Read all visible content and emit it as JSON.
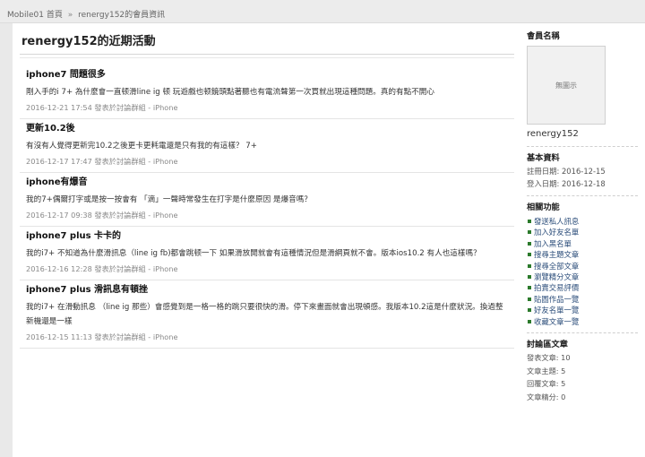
{
  "breadcrumb": {
    "site": "Mobile01 首頁",
    "separator": "»",
    "current": "renergy152的會員資訊"
  },
  "main": {
    "title": "renergy152的近期活動",
    "posts": [
      {
        "title": "iphone7 問題很多",
        "excerpt": "剛入手的i 7+ 為什麼會一直顿滑line ig 顿 玩遊戲也顿鏡頭點著聽也有電流聲第一次買就出現這種問題。真的有點不開心",
        "date": "2016-12-21 17:54",
        "meta_text": "發表於討論群組 - ",
        "forum": "iPhone"
      },
      {
        "title": "更新10.2後",
        "excerpt": "有沒有人覺得更新完10.2之後更卡更耗電還是只有我的有這樣？ 7+",
        "date": "2016-12-17 17:47",
        "meta_text": "發表於討論群組 - ",
        "forum": "iPhone"
      },
      {
        "title": "iphone有爆音",
        "excerpt": "我的7+偶爾打字或是按一按會有 「滴」一聲時常發生在打字是什麼原因 是爆音嗎？",
        "date": "2016-12-17 09:38",
        "meta_text": "發表於討論群組 - ",
        "forum": "iPhone"
      },
      {
        "title": "iphone7 plus 卡卡的",
        "excerpt": "我的i7+ 不知道為什麼滑訊息（line ig fb)都會跳顿一下 如果滑放開就會有這種情況但是滑網頁就不會。版本ios10.2 有人也這樣嗎？",
        "date": "2016-12-16 12:28",
        "meta_text": "發表於討論群組 - ",
        "forum": "iPhone"
      },
      {
        "title": "iphone7 plus 滑訊息有頓挫",
        "excerpt": "我的i7+ 在滑動訊息 （line ig 那些）會感覺到是一格一格的跳只要很快的滑。停下來畫面就會出現頓感。我版本10.2這是什麼狀況。換過整新機還是一樣",
        "date": "2016-12-15 11:13",
        "meta_text": "發表於討論群組 - ",
        "forum": "iPhone"
      }
    ]
  },
  "sidebar": {
    "member_heading": "會員名稱",
    "avatar_text": "無圖示",
    "username": "renergy152",
    "basic_heading": "基本資料",
    "register_date": "註冊日期: 2016-12-15",
    "login_date": "登入日期: 2016-12-18",
    "functions_heading": "相關功能",
    "functions": [
      "發送私人訊息",
      "加入好友名單",
      "加入黑名單",
      "搜尋主題文章",
      "搜尋全部文章",
      "瀏覽精分文章",
      "拍賣交易評價",
      "貼圖作品一覽",
      "好友名單一覽",
      "收藏文章一覽"
    ],
    "forum_heading": "討論區文章",
    "forum_stats": [
      "發表文章: 10",
      "文章主題: 5",
      "回覆文章: 5",
      "文章精分: 0"
    ]
  }
}
